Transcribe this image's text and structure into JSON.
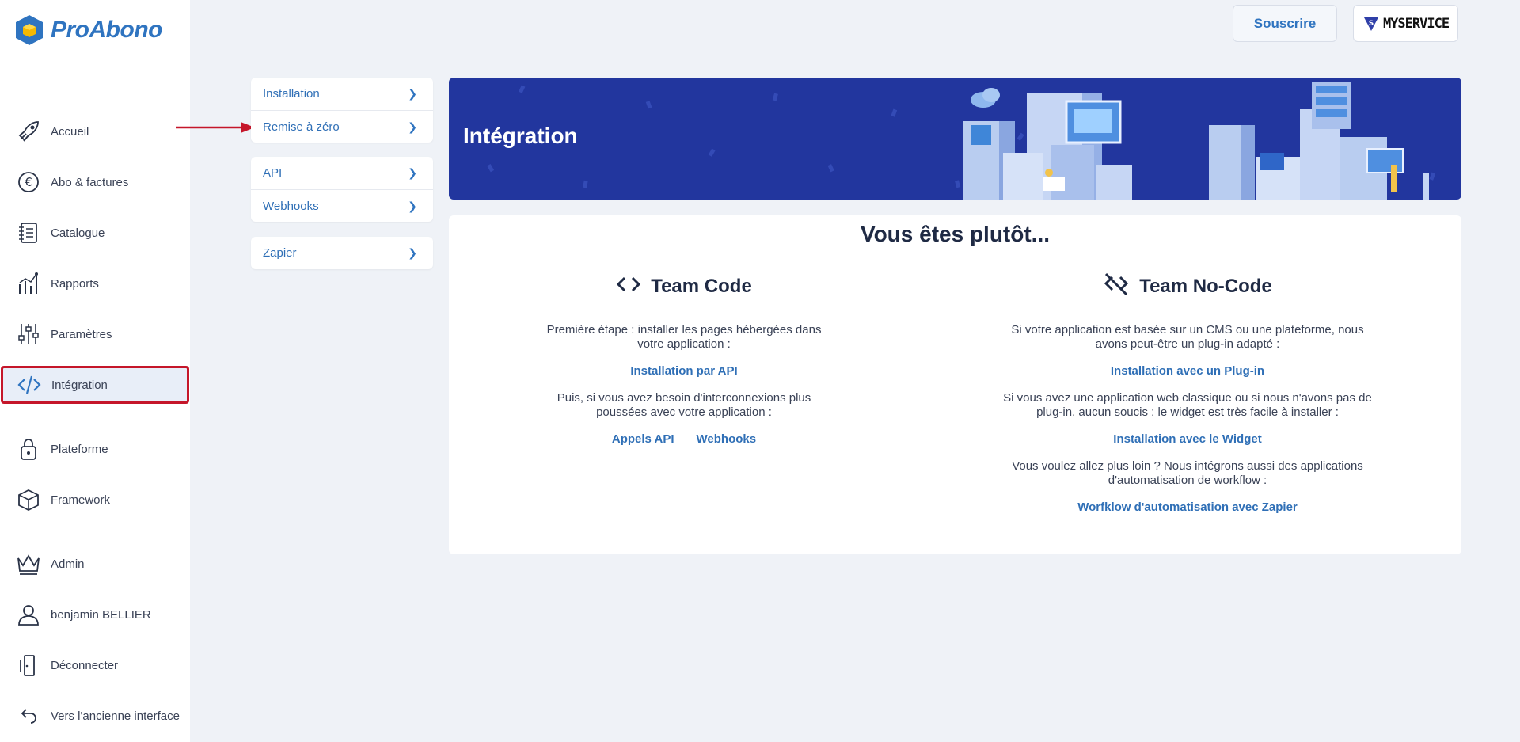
{
  "brand": {
    "name": "ProAbono"
  },
  "sidebar": {
    "items": [
      {
        "label": "Accueil",
        "icon": "rocket-icon"
      },
      {
        "label": "Abo & factures",
        "icon": "euro-icon"
      },
      {
        "label": "Catalogue",
        "icon": "notebook-icon"
      },
      {
        "label": "Rapports",
        "icon": "chart-icon"
      },
      {
        "label": "Paramètres",
        "icon": "sliders-icon"
      },
      {
        "label": "Intégration",
        "icon": "code-icon"
      },
      {
        "label": "Plateforme",
        "icon": "lock-icon"
      },
      {
        "label": "Framework",
        "icon": "cube-icon"
      },
      {
        "label": "Admin",
        "icon": "crown-icon"
      },
      {
        "label": "benjamin BELLIER",
        "icon": "user-icon"
      },
      {
        "label": "Déconnecter",
        "icon": "door-icon"
      },
      {
        "label": "Vers l'ancienne interface",
        "icon": "undo-icon"
      }
    ]
  },
  "topbar": {
    "subscribe_label": "Souscrire",
    "service_label": "MYSERVICE"
  },
  "submenu": {
    "group1": [
      "Installation",
      "Remise à zéro"
    ],
    "group2": [
      "API",
      "Webhooks"
    ],
    "group3": [
      "Zapier"
    ]
  },
  "banner": {
    "title": "Intégration"
  },
  "main": {
    "title": "Vous êtes plutôt...",
    "team_code": {
      "heading": "Team Code",
      "p1": "Première étape : installer les pages hébergées dans votre application :",
      "link1": "Installation par API",
      "p2": "Puis, si vous avez besoin d'interconnexions plus poussées avec votre application :",
      "link2": "Appels API",
      "link3": "Webhooks"
    },
    "team_nocode": {
      "heading": "Team No-Code",
      "p1": "Si votre application est basée sur un CMS ou une plateforme, nous avons peut-être un plug-in adapté :",
      "link1": "Installation avec un Plug-in",
      "p2": "Si vous avez une application web classique ou si nous n'avons pas de plug-in, aucun soucis : le widget est très facile à installer :",
      "link2": "Installation avec le Widget",
      "p3": "Vous voulez allez plus loin ? Nous intégrons aussi des applications d'automatisation de workflow :",
      "link3": "Worfklow d'automatisation avec Zapier"
    }
  },
  "colors": {
    "accent": "#2f74c0",
    "banner": "#22369e",
    "highlight": "#c5162a"
  }
}
